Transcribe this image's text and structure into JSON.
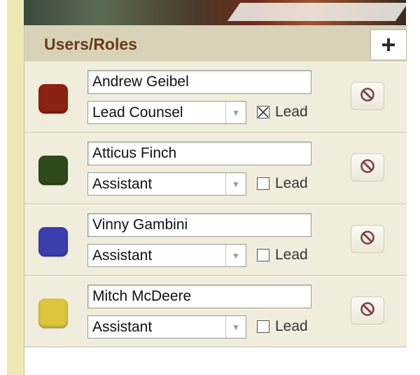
{
  "panel": {
    "title": "Users/Roles",
    "add_label": "+"
  },
  "users": [
    {
      "name": "Andrew Geibel",
      "role": "Lead Counsel",
      "lead": true,
      "lead_label": "Lead",
      "color": "#8b2212"
    },
    {
      "name": "Atticus Finch",
      "role": "Assistant",
      "lead": false,
      "lead_label": "Lead",
      "color": "#2f4a1b"
    },
    {
      "name": "Vinny Gambini",
      "role": "Assistant",
      "lead": false,
      "lead_label": "Lead",
      "color": "#3b3fae"
    },
    {
      "name": "Mitch McDeere",
      "role": "Assistant",
      "lead": false,
      "lead_label": "Lead",
      "color": "#dcc53a"
    }
  ],
  "icons": {
    "add": "plus-icon",
    "remove": "no-entry-icon",
    "dropdown": "triangle-down-icon",
    "checked": "checkbox-x-icon"
  }
}
